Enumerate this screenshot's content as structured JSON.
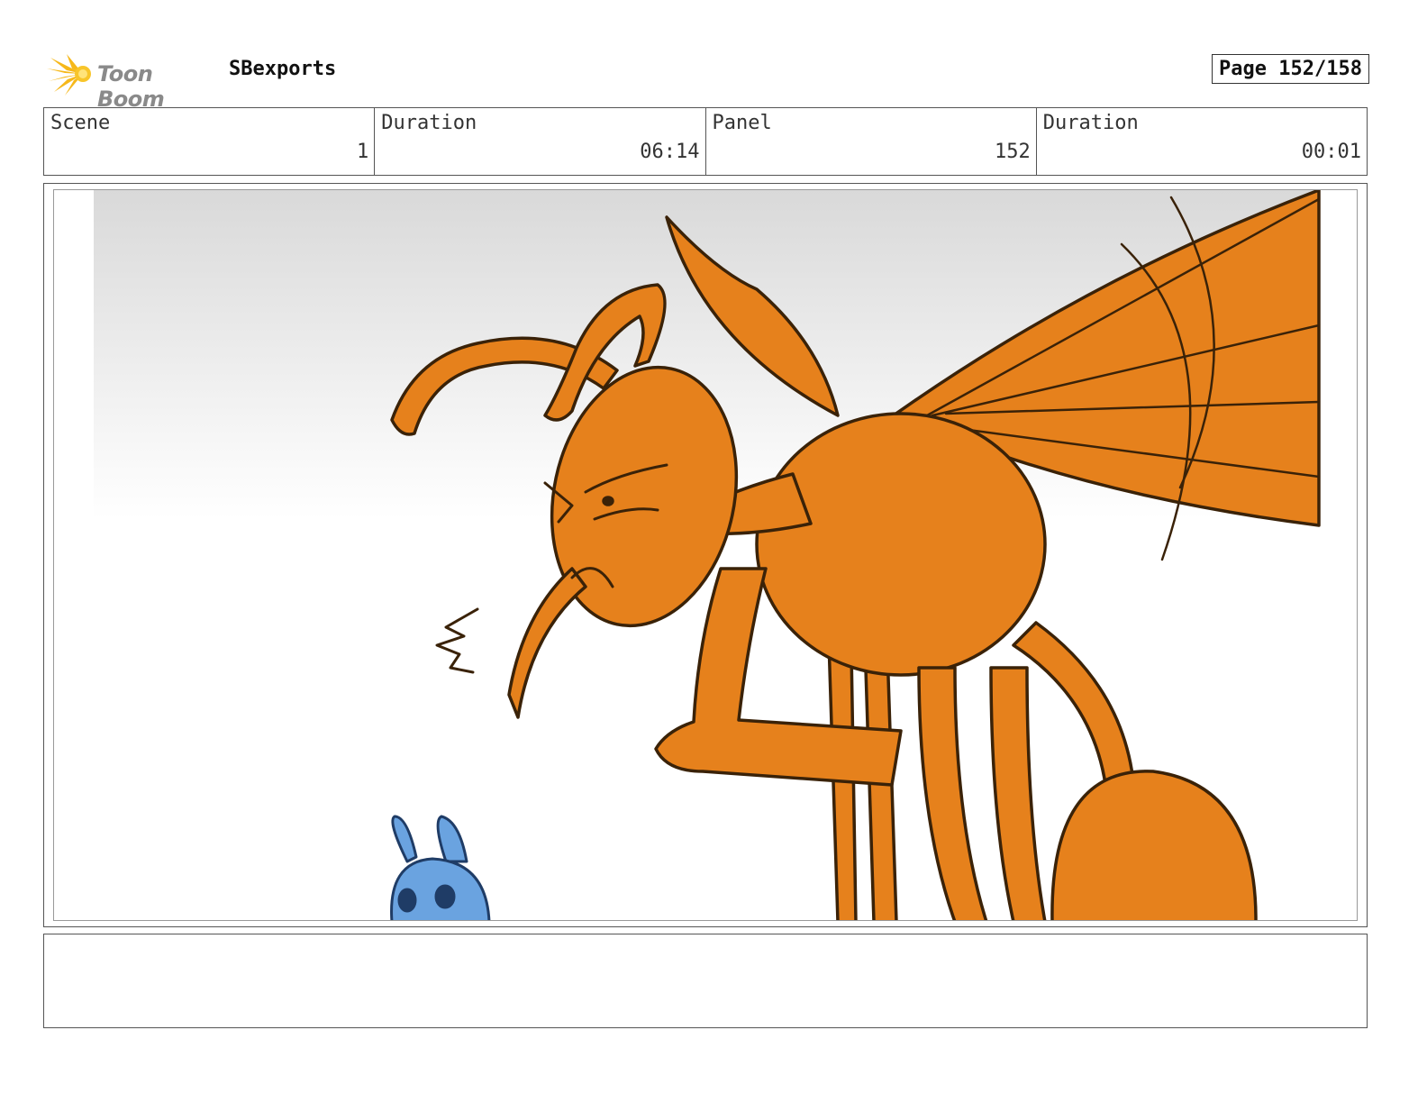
{
  "header": {
    "logo_text": "Toon Boom",
    "project_name": "SBexports",
    "page_label": "Page 152/158"
  },
  "info": {
    "scene_label": "Scene",
    "scene_value": "1",
    "scene_duration_label": "Duration",
    "scene_duration_value": "06:14",
    "panel_label": "Panel",
    "panel_value": "152",
    "panel_duration_label": "Duration",
    "panel_duration_value": "00:01"
  },
  "panel": {
    "colors": {
      "ant_orange": "#E6811C",
      "outline_brown": "#3a2208",
      "bug_blue": "#6aa3e0",
      "sky_gray": "#dcdcdc"
    }
  },
  "notes": {}
}
